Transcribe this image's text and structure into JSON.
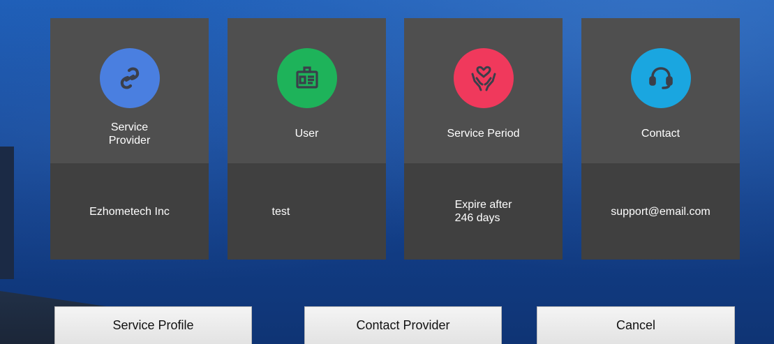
{
  "cards": [
    {
      "title": "Service\nProvider",
      "value": "Ezhometech Inc",
      "icon": "link-icon",
      "color": "#4a7fe0"
    },
    {
      "title": "User",
      "value": "test",
      "icon": "id-badge-icon",
      "color": "#1eb35a"
    },
    {
      "title": "Service Period",
      "value": "Expire after\n246 days",
      "icon": "heart-hands-icon",
      "color": "#f0395c"
    },
    {
      "title": "Contact",
      "value": "support@email.com",
      "icon": "headset-icon",
      "color": "#1aa6e0"
    }
  ],
  "buttons": {
    "service_profile": "Service Profile",
    "contact_provider": "Contact Provider",
    "cancel": "Cancel"
  }
}
